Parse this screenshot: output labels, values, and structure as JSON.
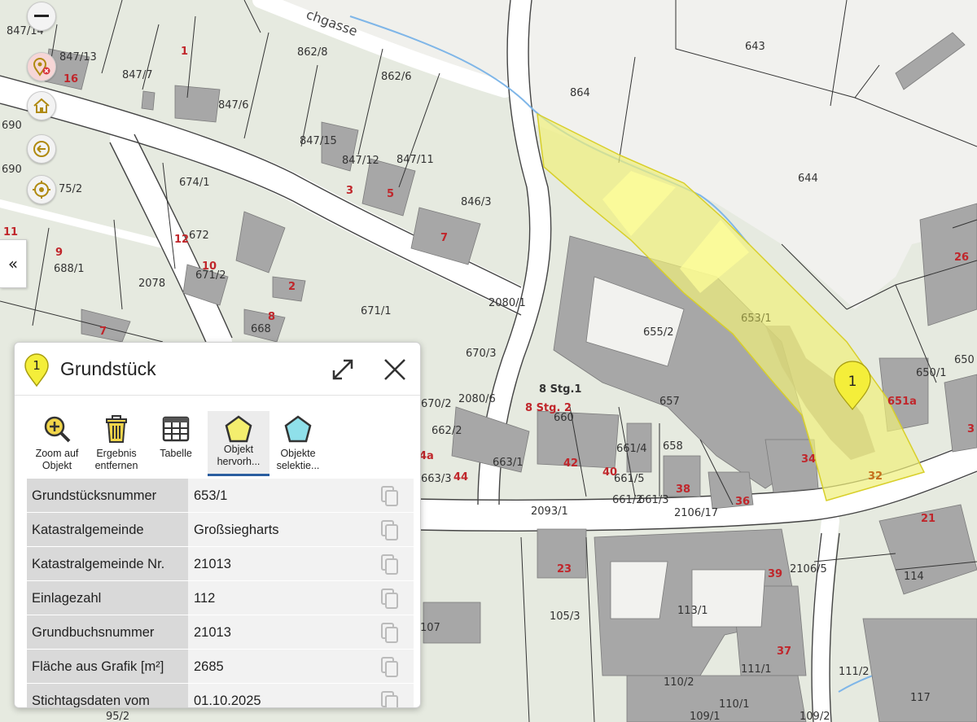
{
  "map": {
    "streets": [
      {
        "name": "chgasse"
      }
    ],
    "parcel_labels": [
      "847/14",
      "847/13",
      "847/7",
      "847/6",
      "862/8",
      "862/6",
      "864",
      "643",
      "644",
      "847/15",
      "847/12",
      "847/11",
      "846/3",
      "674/1",
      "672",
      "671/2",
      "688/1",
      "2078",
      "671/1",
      "2080/1",
      "670/3",
      "655/2",
      "653/1",
      "650/1",
      "668",
      "670/2",
      "2080/6",
      "662/2",
      "663/1",
      "663/3",
      "661/4",
      "658",
      "657",
      "661/5",
      "661/2",
      "661/3",
      "2106/17",
      "2093/1",
      "2106/5",
      "114",
      "113/1",
      "105/3",
      "111/1",
      "111/2",
      "110/2",
      "110/1",
      "109/1",
      "109/2",
      "117",
      "95/2",
      "107",
      "690",
      "690",
      "75/2",
      "650"
    ],
    "house_numbers": [
      "16",
      "1",
      "3",
      "5",
      "7",
      "12",
      "10",
      "9",
      "11",
      "2",
      "8",
      "7",
      "26",
      "34",
      "32",
      "36",
      "38",
      "40",
      "42",
      "44",
      "4a",
      "23",
      "39",
      "37",
      "21",
      "651a",
      "3"
    ],
    "stg_labels": [
      "8 Stg.1",
      "8 Stg. 2",
      "660"
    ],
    "marker_label": "1",
    "highlight_color": "#f0ef7a"
  },
  "controls": {
    "zoom_out_icon": "minus-icon",
    "collapse_label": "«"
  },
  "panel": {
    "marker_number": "1",
    "title": "Grundstück",
    "tools": [
      {
        "line1": "Zoom auf",
        "line2": "Objekt"
      },
      {
        "line1": "Ergebnis",
        "line2": "entfernen"
      },
      {
        "line1": "Tabelle",
        "line2": ""
      },
      {
        "line1": "Objekt",
        "line2": "hervorh..."
      },
      {
        "line1": "Objekte",
        "line2": "selektie..."
      }
    ],
    "rows": [
      {
        "key": "Grundstücksnummer",
        "value": "653/1"
      },
      {
        "key": "Katastralgemeinde",
        "value": "Großsiegharts"
      },
      {
        "key": "Katastralgemeinde Nr.",
        "value": "21013"
      },
      {
        "key": "Einlagezahl",
        "value": "112"
      },
      {
        "key": "Grundbuchsnummer",
        "value": "21013"
      },
      {
        "key": "Fläche aus Grafik [m²]",
        "value": "2685"
      },
      {
        "key": "Stichtagsdaten vom",
        "value": "01.10.2025"
      }
    ]
  }
}
